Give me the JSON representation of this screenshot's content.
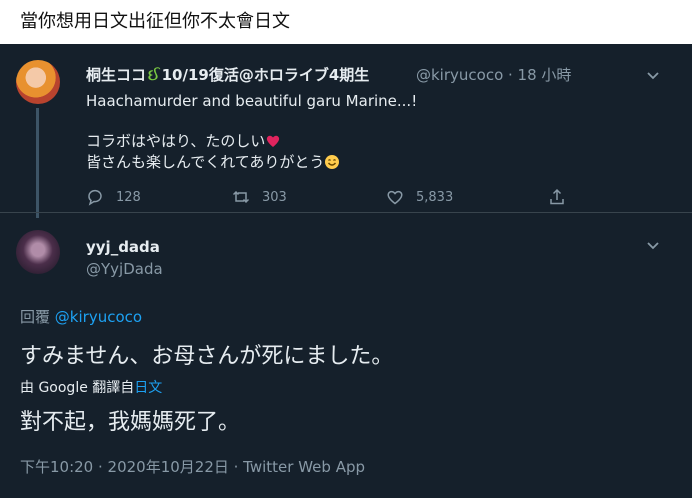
{
  "caption": "當你想用日文出征但你不太會日文",
  "tweet1": {
    "name": "桐生ココ",
    "name_badge": "🐉",
    "name_rest": "10/19復活@ホロライブ4期生",
    "handle": "@kiryucoco · 18 小時",
    "line1": "Haachamurder and beautiful garu Marine...!",
    "line2": "コラボはやはり、たのしい",
    "line3": "皆さんも楽しんでくれてありがとう",
    "replies": "128",
    "retweets": "303",
    "likes": "5,833"
  },
  "tweet2": {
    "name": "yyj_dada",
    "handle": "@YyjDada",
    "reply_label": "回覆",
    "reply_mention": "@kiryucoco",
    "text": "すみません、お母さんが死にました。",
    "translate_prefix": "由 Google 翻譯自",
    "translate_lang": "日文",
    "translated": "對不起，我媽媽死了。",
    "footer": "下午10:20 · 2020年10月22日 · Twitter Web App"
  },
  "colors": {
    "background": "#15202b",
    "text": "#e6ecf0",
    "secondary": "#8899a6",
    "accent": "#1da1f2",
    "heart_emoji": "#e0245e"
  },
  "icons": {
    "reply": "comment-icon",
    "retweet": "retweet-icon",
    "like": "heart-icon",
    "share": "share-icon",
    "more": "chevron-down-icon"
  }
}
